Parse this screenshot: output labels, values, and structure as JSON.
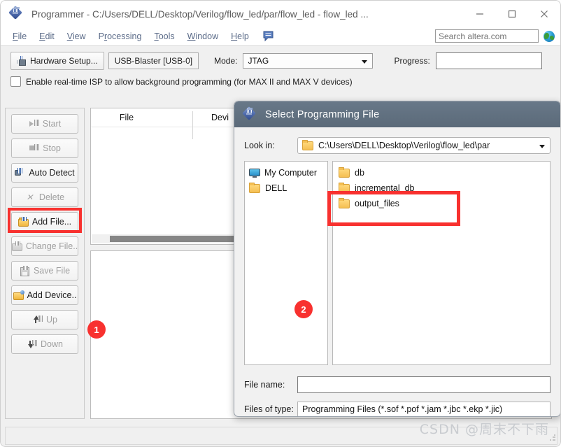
{
  "window": {
    "title": "Programmer - C:/Users/DELL/Desktop/Verilog/flow_led/par/flow_led - flow_led ...",
    "icon": "altera-diamond-icon",
    "controls": {
      "minimize": "minimize-icon",
      "maximize": "maximize-icon",
      "close": "close-icon"
    }
  },
  "menu": {
    "items": [
      {
        "label": "File",
        "mnemonic": "F"
      },
      {
        "label": "Edit",
        "mnemonic": "E"
      },
      {
        "label": "View",
        "mnemonic": "V"
      },
      {
        "label": "Processing",
        "mnemonic": "r"
      },
      {
        "label": "Tools",
        "mnemonic": "T"
      },
      {
        "label": "Window",
        "mnemonic": "W"
      },
      {
        "label": "Help",
        "mnemonic": "H"
      }
    ],
    "feedback_icon": "speech-bubble-icon",
    "search": {
      "placeholder": "Search altera.com",
      "value": ""
    },
    "globe_icon": "globe-icon"
  },
  "toolbar": {
    "hardware_setup_label": "Hardware Setup...",
    "hardware_value": "USB-Blaster [USB-0]",
    "mode_label": "Mode:",
    "mode_value": "JTAG",
    "progress_label": "Progress:",
    "progress_value": "",
    "isp_checkbox_label": "Enable real-time ISP to allow background programming (for MAX II and MAX V devices)",
    "isp_checked": false
  },
  "side_buttons": [
    {
      "label": "Start",
      "icon": "play-icon",
      "enabled": false
    },
    {
      "label": "Stop",
      "icon": "stop-icon",
      "enabled": false
    },
    {
      "label": "Auto Detect",
      "icon": "binoculars-icon",
      "enabled": true
    },
    {
      "label": "Delete",
      "icon": "delete-x-icon",
      "enabled": false
    },
    {
      "label": "Add File...",
      "icon": "folder-open-icon",
      "enabled": true
    },
    {
      "label": "Change File..",
      "icon": "folder-gray-icon",
      "enabled": false
    },
    {
      "label": "Save File",
      "icon": "floppy-disk-icon",
      "enabled": false
    },
    {
      "label": "Add Device..",
      "icon": "folder-device-icon",
      "enabled": true
    },
    {
      "label": "Up",
      "icon": "arrow-up-icon",
      "enabled": false
    },
    {
      "label": "Down",
      "icon": "arrow-down-icon",
      "enabled": false
    }
  ],
  "table": {
    "columns": [
      "File",
      "Devi"
    ],
    "rows": []
  },
  "annotations": [
    {
      "id": "1",
      "target": "add-file-button",
      "color": "#f8312f"
    },
    {
      "id": "2",
      "target": "output-files-folder",
      "color": "#f8312f"
    }
  ],
  "dialog": {
    "title": "Select Programming File",
    "icon": "altera-diamond-icon",
    "lookin_label": "Look in:",
    "lookin_path": "C:\\Users\\DELL\\Desktop\\Verilog\\flow_led\\par",
    "places": [
      {
        "label": "My Computer",
        "icon": "monitor-icon"
      },
      {
        "label": "DELL",
        "icon": "folder-icon"
      }
    ],
    "files": [
      {
        "name": "db",
        "icon": "folder-icon"
      },
      {
        "name": "incremental_db",
        "icon": "folder-icon"
      },
      {
        "name": "output_files",
        "icon": "folder-icon",
        "highlighted": true
      }
    ],
    "filename_label": "File name:",
    "filename_value": "",
    "filetype_label": "Files of type:",
    "filetype_value": "Programming Files (*.sof *.pof *.jam *.jbc *.ekp *.jic)"
  },
  "watermark": "CSDN @周末不下雨"
}
